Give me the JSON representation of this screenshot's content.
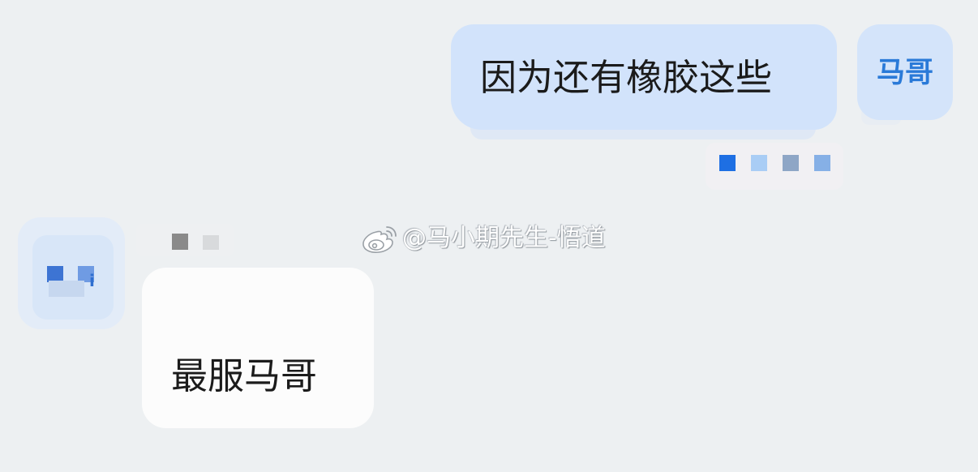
{
  "watermark": {
    "icon": "weibo-icon",
    "text": "@马小期先生-悟道"
  },
  "messages": [
    {
      "direction": "outgoing",
      "text": "因为还有橡胶这些",
      "avatar_label": "马哥"
    },
    {
      "direction": "incoming",
      "sender_name": "",
      "avatar_glyph": "i",
      "text": "最服马哥"
    }
  ],
  "status_colors": [
    "#1e6fe3",
    "#a9cdf5",
    "#8ea6c6",
    "#86b0e6"
  ],
  "colors": {
    "background": "#edf0f2",
    "outgoing_bubble": "#d2e3fb",
    "incoming_bubble": "#fcfcfc",
    "avatar_accent": "#2a7ad8"
  }
}
